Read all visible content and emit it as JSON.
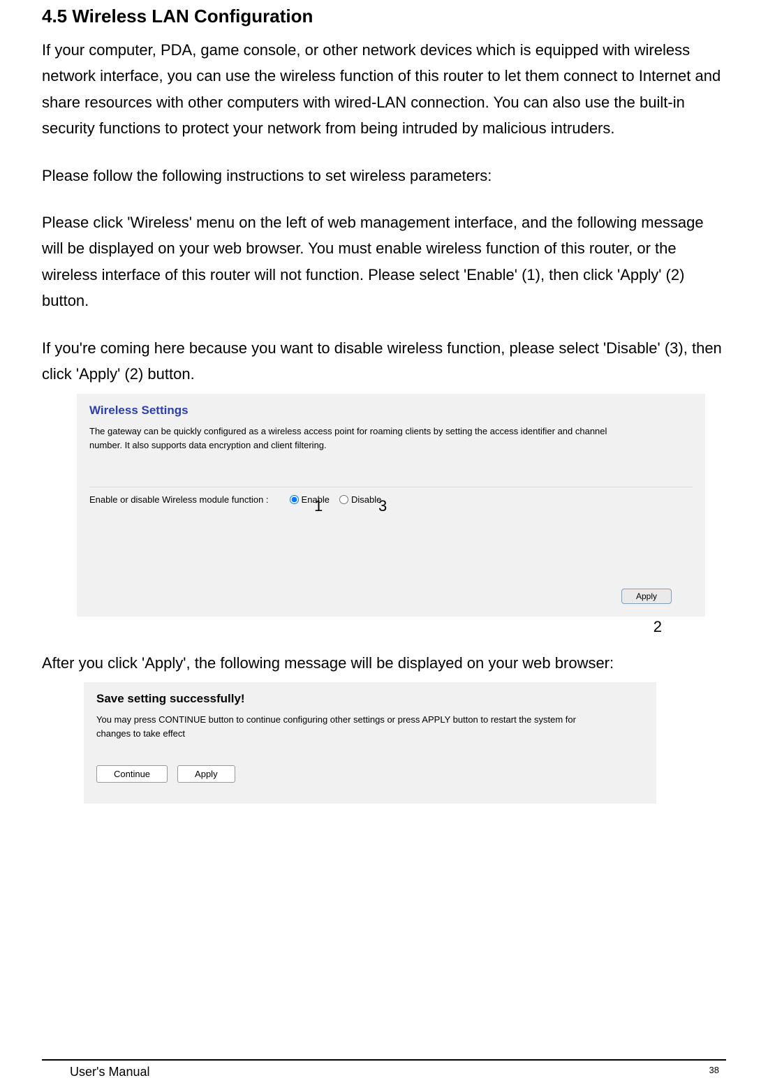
{
  "heading": "4.5 Wireless LAN Configuration",
  "para1": "If your computer, PDA, game console, or other network devices which is equipped with wireless network interface, you can use the wireless function of this router to let them connect to Internet and share resources with other computers with wired-LAN connection. You can also use the built-in security functions to protect your network from being intruded by malicious intruders.",
  "para2": "Please follow the following instructions to set wireless parameters:",
  "para3": "Please click 'Wireless' menu on the left of web management interface, and the following message will be displayed on your web browser. You must enable wireless function of this router, or the wireless interface of this router will not function. Please select 'Enable' (1), then click 'Apply' (2) button.",
  "para4": "If you're coming here because you want to disable wireless function, please select 'Disable' (3), then click 'Apply' (2) button.",
  "screenshot1": {
    "title": "Wireless Settings",
    "desc": "The gateway can be quickly configured as a wireless access point for roaming clients by setting the access identifier and channel number. It also supports data encryption and client filtering.",
    "label": "Enable or disable Wireless module function :",
    "opt_enable": "Enable",
    "opt_disable": "Disable",
    "apply": "Apply",
    "annot1": "1",
    "annot3": "3",
    "annot2": "2"
  },
  "para5": "After you click 'Apply', the following message will be displayed on your web browser:",
  "screenshot2": {
    "title": "Save setting successfully!",
    "desc": "You may press CONTINUE button to continue configuring other settings or press APPLY button to restart the system for changes to take effect",
    "continue": "Continue",
    "apply": "Apply"
  },
  "footer": {
    "left": "User's Manual",
    "page": "38"
  }
}
